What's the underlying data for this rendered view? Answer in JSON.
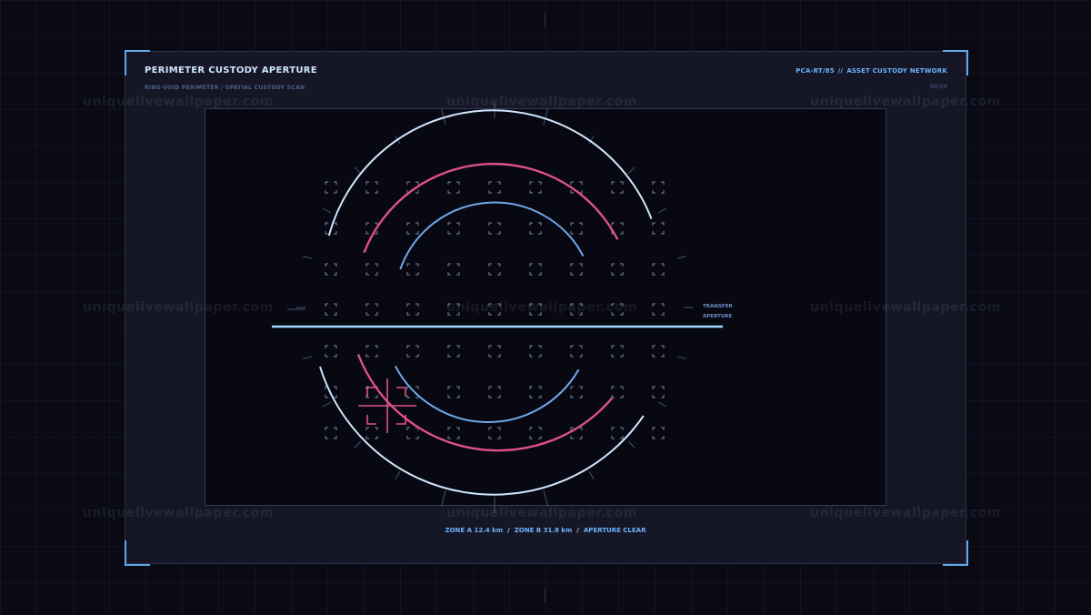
{
  "header": {
    "title": "PERIMETER CUSTODY APERTURE",
    "subtitle": "RING-VOID PERIMETER / SPATIAL CUSTODY SCAN",
    "code": "PCA-RT/85",
    "separator": "//",
    "network": "ASSET CUSTODY NETWORK",
    "page": "09/19"
  },
  "scan": {
    "label_line1": "TRANSFER",
    "label_line2": "APERTURE"
  },
  "footer": {
    "zone_a": "ZONE A 12.4 km",
    "zone_b": "ZONE B 31.8 km",
    "status": "APERTURE CLEAR",
    "separator": "/"
  },
  "watermark": "uniquelivewallpaper.com",
  "colors": {
    "background": "#090a14",
    "panel": "#161726",
    "accent_blue": "#6cb4ff",
    "outer_ring": "#cfe6ff",
    "middle_ring": "#e0508e",
    "inner_ring": "#6fa8e8",
    "target_marker": "#e0508e",
    "transfer_line": "#9fd8ff"
  },
  "icons": {
    "target": "crosshair-target-icon",
    "grid_marker": "bracket-marker-icon"
  }
}
